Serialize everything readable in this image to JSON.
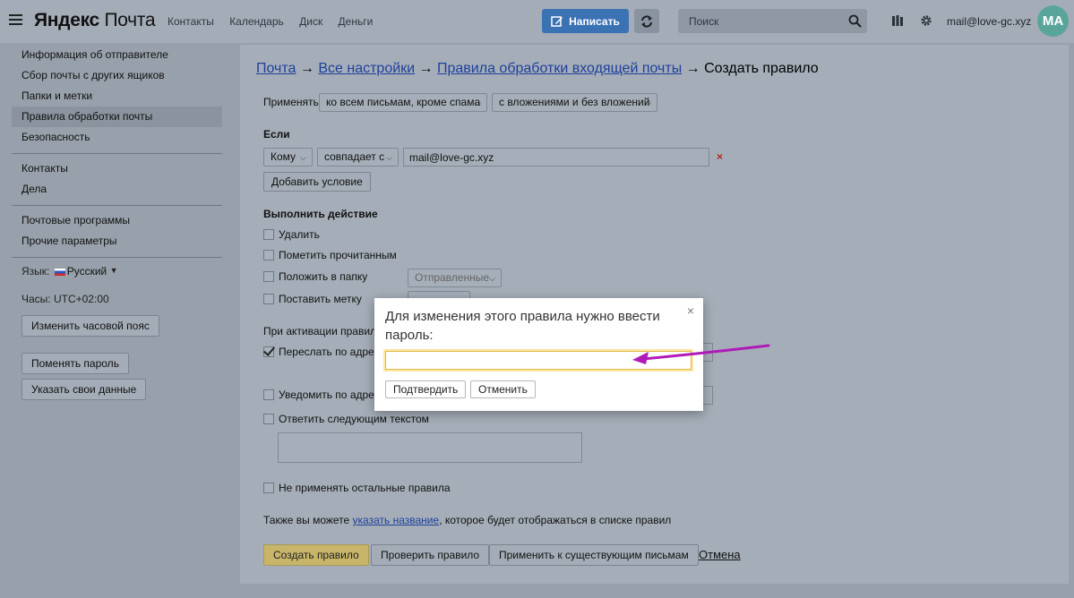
{
  "header": {
    "logo_brand": "Яндекс",
    "logo_product": "Почта",
    "nav": [
      "Контакты",
      "Календарь",
      "Диск",
      "Деньги"
    ],
    "compose_label": "Написать",
    "search_placeholder": "Поиск",
    "account_email": "mail@love-gc.xyz",
    "avatar_initials": "MA",
    "colors": {
      "compose": "#3b72b4",
      "avatar": "#5aa59a"
    },
    "icons": [
      "menu-icon",
      "pencil-icon",
      "refresh-icon",
      "search-icon",
      "panel-icon",
      "gear-icon"
    ]
  },
  "sidebar": {
    "group1": [
      "Информация об отправителе",
      "Сбор почты с других ящиков",
      "Папки и метки",
      "Правила обработки почты",
      "Безопасность"
    ],
    "active_item": "Правила обработки почты",
    "group2": [
      "Контакты",
      "Дела"
    ],
    "group3": [
      "Почтовые программы",
      "Прочие параметры"
    ],
    "lang_label": "Язык:",
    "lang_value": "Русский",
    "tz_label": "Часы: UTC+02:00",
    "btn_change_tz": "Изменить часовой пояс",
    "btn_change_password": "Поменять пароль",
    "btn_personal": "Указать свои данные"
  },
  "main": {
    "breadcrumb": {
      "mail": "Почта",
      "settings": "Все настройки",
      "rules": "Правила обработки входящей почты",
      "current": "Создать правило",
      "sep": "→"
    },
    "apply_label": "Применять",
    "apply_scope": "ко всем письмам, кроме спама",
    "apply_attach": "с вложениями и без вложений",
    "if_label": "Если",
    "cond_field": "Кому",
    "cond_op": "совпадает с",
    "cond_value": "mail@love-gc.xyz",
    "remove_mark": "×",
    "add_condition": "Добавить условие",
    "action_label": "Выполнить действие",
    "actions": {
      "delete": "Удалить",
      "mark_read": "Пометить прочитанным",
      "move_folder": "Положить в папку",
      "folder_value": "Отправленные",
      "set_label": "Поставить метку",
      "activation_note": "При активации правил п",
      "forward": "Переслать по адресу",
      "notify": "Уведомить по адресу",
      "reply": "Ответить следующим текстом",
      "stop_rules": "Не применять остальные правила"
    },
    "forward_checked": true,
    "name_note_before": "Также вы можете ",
    "name_note_link": "указать название",
    "name_note_after": ", которое будет отображаться в списке правил",
    "btn_create": "Создать правило",
    "btn_check": "Проверить правило",
    "btn_apply_existing": "Применить к существующим письмам",
    "cancel": "Отмена"
  },
  "modal": {
    "message": "Для изменения этого правила нужно ввести пароль:",
    "close": "×",
    "password_value": "",
    "confirm": "Подтвердить",
    "cancel": "Отменить",
    "arrow_color": "#b01ab8"
  }
}
